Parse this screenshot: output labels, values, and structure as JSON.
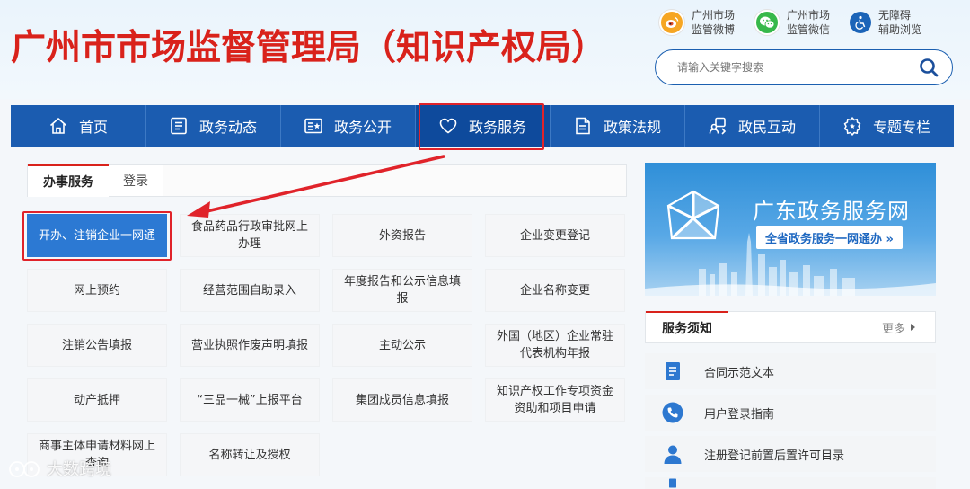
{
  "header": {
    "title": "广州市市场监督管理局（知识产权局）",
    "quick_links": [
      {
        "icon": "weibo-icon",
        "line1": "广州市场",
        "line2": "监管微博"
      },
      {
        "icon": "wechat-icon",
        "line1": "广州市场",
        "line2": "监管微信"
      },
      {
        "icon": "accessibility-icon",
        "line1": "无障碍",
        "line2": "辅助浏览"
      }
    ],
    "search": {
      "placeholder": "请输入关键字搜索",
      "value": ""
    }
  },
  "nav": {
    "items": [
      {
        "label": "首页",
        "icon": "home-icon"
      },
      {
        "label": "政务动态",
        "icon": "news-icon"
      },
      {
        "label": "政务公开",
        "icon": "open-gov-icon"
      },
      {
        "label": "政务服务",
        "icon": "heart-icon",
        "active": true
      },
      {
        "label": "政策法规",
        "icon": "document-icon"
      },
      {
        "label": "政民互动",
        "icon": "interaction-icon"
      },
      {
        "label": "专题专栏",
        "icon": "gear-icon"
      }
    ]
  },
  "tabs": [
    {
      "label": "办事服务",
      "active": true
    },
    {
      "label": "登录",
      "active": false
    }
  ],
  "services": [
    "开办、注销企业一网通",
    "食品药品行政审批网上办理",
    "外资报告",
    "企业变更登记",
    "网上预约",
    "经营范围自助录入",
    "年度报告和公示信息填报",
    "企业名称变更",
    "注销公告填报",
    "营业执照作废声明填报",
    "主动公示",
    "外国（地区）企业常驻代表机构年报",
    "动产抵押",
    "“三品一械”上报平台",
    "集团成员信息填报",
    "知识产权工作专项资金资助和项目申请",
    "商事主体申请材料网上查询",
    "名称转让及授权"
  ],
  "banner": {
    "title": "广东政务服务网",
    "subtitle": "全省政务服务一网通办 »"
  },
  "notices": {
    "title": "服务须知",
    "more": "更多",
    "items": [
      {
        "label": "合同示范文本",
        "icon": "contract-icon"
      },
      {
        "label": "用户登录指南",
        "icon": "phone-icon"
      },
      {
        "label": "注册登记前置后置许可目录",
        "icon": "user-icon"
      }
    ]
  },
  "watermark": "大数跨境",
  "colors": {
    "brand_red": "#d9221b",
    "nav_blue": "#1b5cb0",
    "primary_btn": "#2c79d3",
    "highlight_red": "#e0232a"
  }
}
